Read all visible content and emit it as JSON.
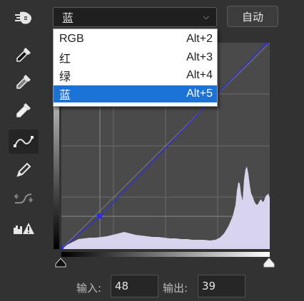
{
  "toolbar": {
    "tools": [
      {
        "name": "on-image-adjust-tool",
        "icon": "hand-adjust-icon"
      },
      {
        "name": "sample-black-point",
        "icon": "black-eyedropper-icon"
      },
      {
        "name": "sample-gray-point",
        "icon": "gray-eyedropper-icon"
      },
      {
        "name": "sample-white-point",
        "icon": "white-eyedropper-icon"
      },
      {
        "name": "edit-points-curve",
        "icon": "curve-points-icon",
        "active": true
      },
      {
        "name": "draw-curve",
        "icon": "pencil-icon"
      },
      {
        "name": "smooth-curve",
        "icon": "smooth-curve-icon"
      },
      {
        "name": "clipping-warning",
        "icon": "histogram-warning-icon"
      }
    ]
  },
  "channel": {
    "selected": "蓝",
    "chevron": "⌵",
    "options": [
      {
        "label": "RGB",
        "shortcut": "Alt+2"
      },
      {
        "label": "红",
        "shortcut": "Alt+3"
      },
      {
        "label": "绿",
        "shortcut": "Alt+4"
      },
      {
        "label": "蓝",
        "shortcut": "Alt+5",
        "selected": true
      }
    ]
  },
  "auto_button": {
    "label": "自动"
  },
  "curve": {
    "input_label": "输入:",
    "input_value": "48",
    "output_label": "输出:",
    "output_value": "39",
    "colors": {
      "curve": "#2f2fd6",
      "histogram": "#d8d4ee",
      "selection": "#1b73d8"
    }
  }
}
